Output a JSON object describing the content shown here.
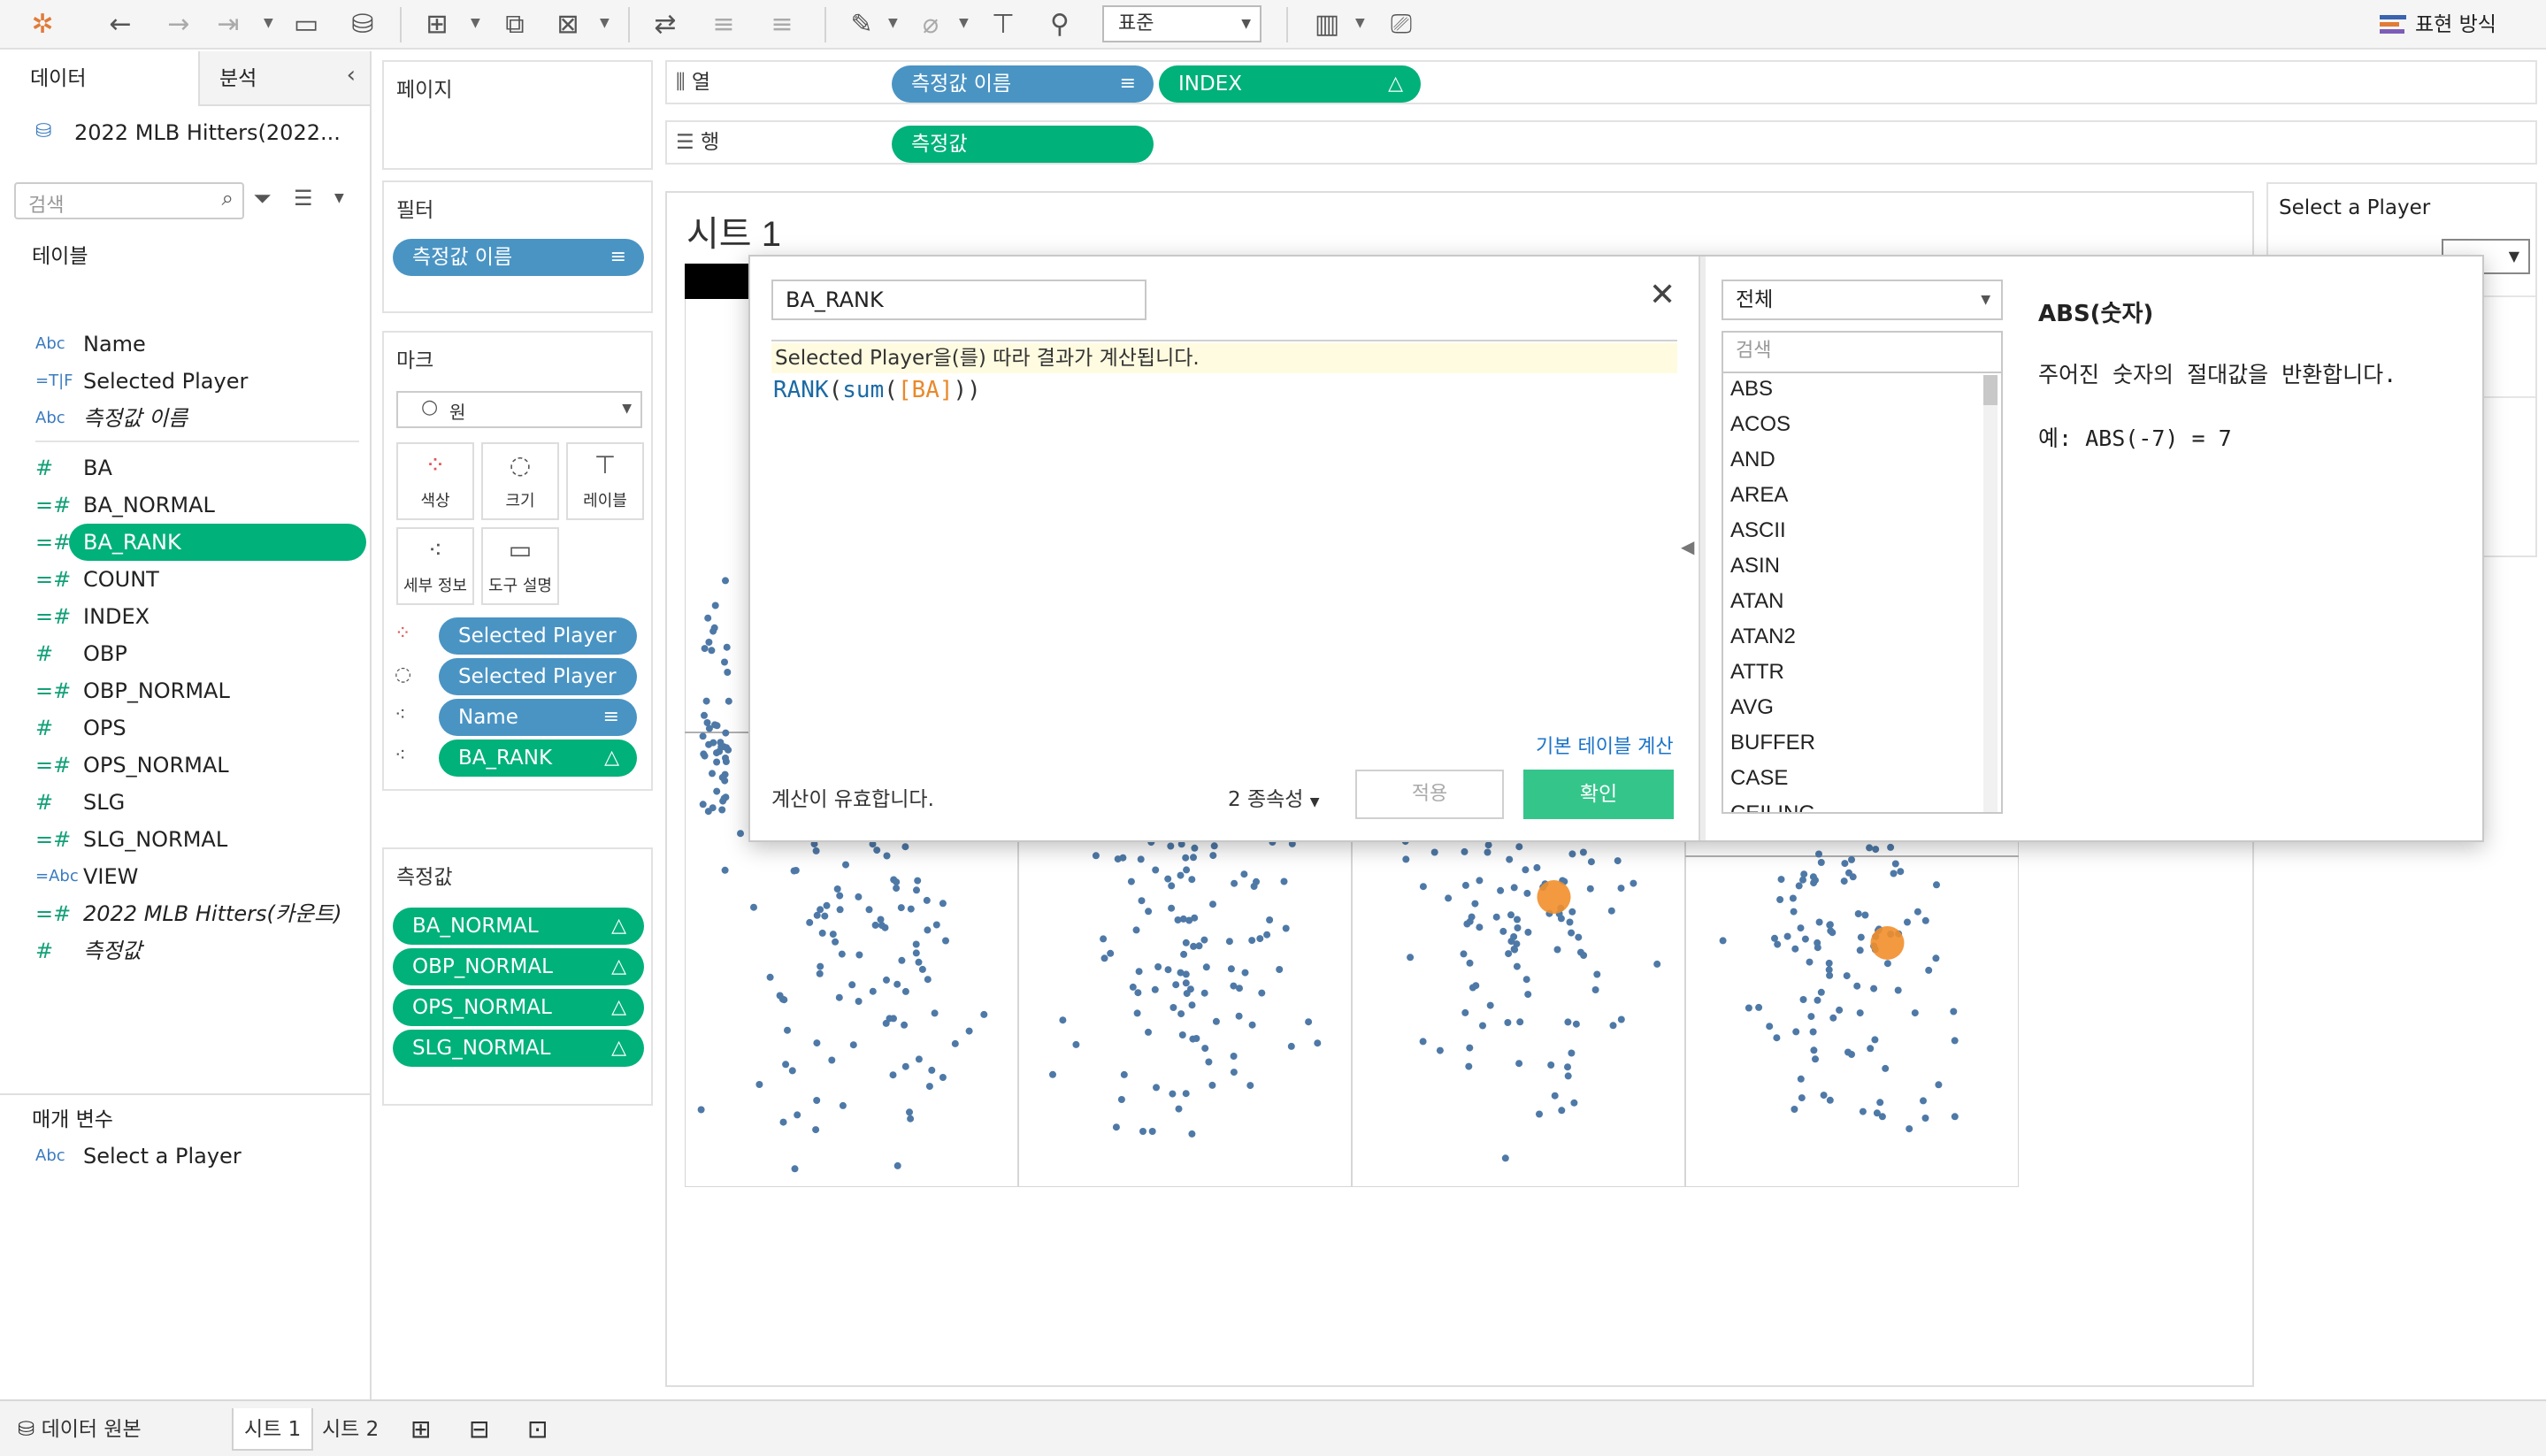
{
  "toolbar": {
    "standard_option": "표준",
    "show_me_label": "표현 방식"
  },
  "data_pane": {
    "tabs": [
      "데이터",
      "분석"
    ],
    "datasource": "2022 MLB Hitters(2022...",
    "search_placeholder": "검색",
    "tables_header": "테이블",
    "fields": [
      {
        "type": "Abc",
        "name": "Name"
      },
      {
        "type": "=T|F",
        "name": "Selected Player"
      },
      {
        "type": "Abc",
        "name": "측정값 이름"
      },
      {
        "type": "#",
        "name": "BA"
      },
      {
        "type": "=#",
        "name": "BA_NORMAL"
      },
      {
        "type": "=#",
        "name": "BA_RANK"
      },
      {
        "type": "=#",
        "name": "COUNT"
      },
      {
        "type": "=#",
        "name": "INDEX"
      },
      {
        "type": "#",
        "name": "OBP"
      },
      {
        "type": "=#",
        "name": "OBP_NORMAL"
      },
      {
        "type": "#",
        "name": "OPS"
      },
      {
        "type": "=#",
        "name": "OPS_NORMAL"
      },
      {
        "type": "#",
        "name": "SLG"
      },
      {
        "type": "=#",
        "name": "SLG_NORMAL"
      },
      {
        "type": "=Abc",
        "name": "VIEW"
      },
      {
        "type": "=#",
        "name": "2022 MLB Hitters(카운트)"
      },
      {
        "type": "#",
        "name": "측정값"
      }
    ],
    "params_header": "매개 변수",
    "param": {
      "type": "Abc",
      "name": "Select a Player"
    }
  },
  "pages_card": {
    "title": "페이지"
  },
  "filters_card": {
    "title": "필터",
    "pill": "측정값 이름"
  },
  "marks_card": {
    "title": "마크",
    "mark_type": "원",
    "buttons": [
      "색상",
      "크기",
      "레이블",
      "세부 정보",
      "도구 설명"
    ],
    "pills": [
      "Selected Player",
      "Selected Player",
      "Name",
      "BA_RANK"
    ]
  },
  "measures_card": {
    "title": "측정값",
    "pills": [
      "BA_NORMAL",
      "OBP_NORMAL",
      "OPS_NORMAL",
      "SLG_NORMAL"
    ]
  },
  "shelves": {
    "columns_label": "열",
    "rows_label": "행",
    "columns_pills": [
      "측정값 이름",
      "INDEX"
    ],
    "rows_pills": [
      "측정값"
    ]
  },
  "sheet": {
    "title": "시트 1"
  },
  "param_card": {
    "title": "Select a Player"
  },
  "calc_dialog": {
    "name": "BA_RANK",
    "note": "Selected Player을(를) 따라 결과가 계산됩니다.",
    "formula": {
      "fn_rank": "RANK",
      "fn_sum": "sum",
      "arg": "[BA]"
    },
    "default_table_link": "기본 테이블 계산",
    "valid_message": "계산이 유효합니다.",
    "dependencies": "2 종속성",
    "apply_label": "적용",
    "ok_label": "확인",
    "category": "전체",
    "fn_search_placeholder": "검색",
    "functions": [
      "ABS",
      "ACOS",
      "AND",
      "AREA",
      "ASCII",
      "ASIN",
      "ATAN",
      "ATAN2",
      "ATTR",
      "AVG",
      "BUFFER",
      "CASE",
      "CEILING"
    ],
    "help_title": "ABS(숫자)",
    "help_desc": "주어진 숫자의 절대값을 반환합니다.",
    "help_example": "예: ABS(-7) = 7"
  },
  "bottom_bar": {
    "datasource_tab": "데이터 원본",
    "sheet_tabs": [
      "시트 1",
      "시트 2"
    ]
  },
  "colors": {
    "green_pill": "#00b17a",
    "blue_pill": "#4a94c4",
    "dot": "#4e79a7",
    "highlight": "#f28e2b"
  }
}
